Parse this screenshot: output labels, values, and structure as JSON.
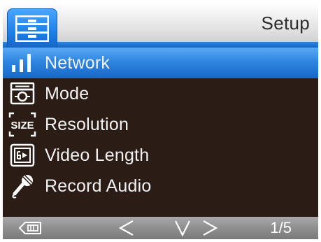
{
  "header": {
    "title": "Setup",
    "tab_icon": "settings-list-icon"
  },
  "menu": {
    "items": [
      {
        "label": "Network",
        "icon": "signal-bars-icon",
        "selected": true
      },
      {
        "label": "Mode",
        "icon": "camera-mode-icon",
        "selected": false
      },
      {
        "label": "Resolution",
        "icon": "size-icon",
        "selected": false
      },
      {
        "label": "Video Length",
        "icon": "video-length-icon",
        "selected": false
      },
      {
        "label": "Record Audio",
        "icon": "microphone-icon",
        "selected": false
      }
    ]
  },
  "footer": {
    "back_icon": "back-icon",
    "left_icon": "left-arrow-icon",
    "down_icon": "down-arrow-icon",
    "right_icon": "right-arrow-icon",
    "page": "1/5"
  },
  "colors": {
    "accent": "#1d7ee6",
    "menu_bg": "#2b1c16",
    "footer_bg": "#8f8f8f"
  }
}
